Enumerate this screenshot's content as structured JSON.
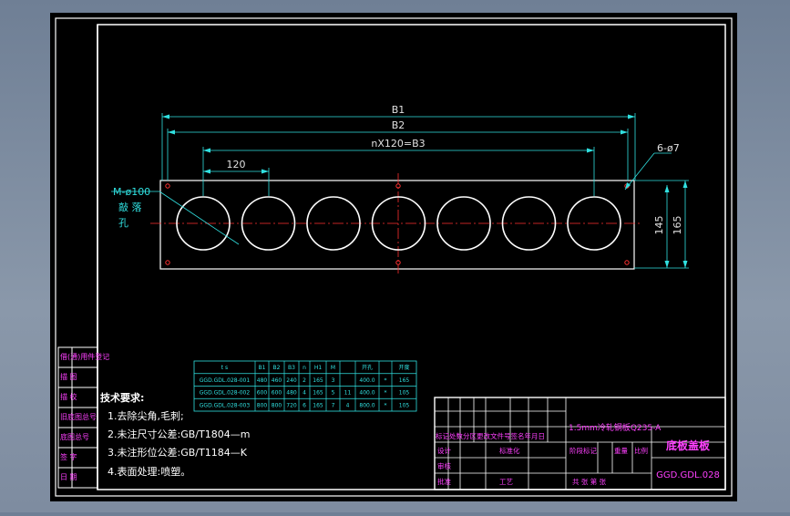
{
  "drawing": {
    "dims": {
      "b1": "B1",
      "b2": "B2",
      "b3": "nX120=B3",
      "pitch": "120",
      "holes": "6-ø7",
      "knock_line1": "M-ø100",
      "knock_line2": "敲 落",
      "knock_line3": "孔",
      "h_inner": "145",
      "h_outer": "165"
    },
    "circle_count": 7
  },
  "spec_table": {
    "headers": [
      "t s",
      "B1",
      "B2",
      "B3",
      "n",
      "H1",
      "M",
      "",
      "开孔",
      "",
      "开度"
    ],
    "rows": [
      [
        "GGD.GDL.028-001",
        "480",
        "460",
        "240",
        "2",
        "165",
        "3",
        "",
        "400.0",
        "*",
        "165"
      ],
      [
        "GGD.GDL.028-002",
        "600",
        "600",
        "480",
        "4",
        "165",
        "5",
        "11",
        "400.0",
        "*",
        "105"
      ],
      [
        "GGD.GDL.028-003",
        "800",
        "800",
        "720",
        "6",
        "165",
        "7",
        "4",
        "800.0",
        "*",
        "105"
      ]
    ]
  },
  "tech_requirements": {
    "title": "技术要求:",
    "items": [
      "1.去除尖角,毛刺;",
      "2.未注尺寸公差:GB/T1804—m",
      "3.未注形位公差:GB/T1184—K",
      "4.表面处理:喷塑。"
    ]
  },
  "left_stamps": [
    "借(通)用件登记",
    "描  图",
    "描  校",
    "旧底图总号",
    "底图总号",
    "签  字",
    "日  期"
  ],
  "title_block": {
    "material": "1.5mm冷轧钢板Q235-A",
    "part_name": "底板盖板",
    "drawing_number": "GGD.GDL.028",
    "row_labels": [
      "标记",
      "处数",
      "分区",
      "更改文件号",
      "签名",
      "年月日"
    ],
    "row2_labels": [
      "设计",
      "标准化"
    ],
    "row3_labels": [
      "审核",
      "工艺"
    ],
    "row4_labels": [
      "批准"
    ],
    "mid_labels": [
      "阶段标记",
      "重量",
      "比例"
    ],
    "sheet_label": "共  张  第  张"
  }
}
